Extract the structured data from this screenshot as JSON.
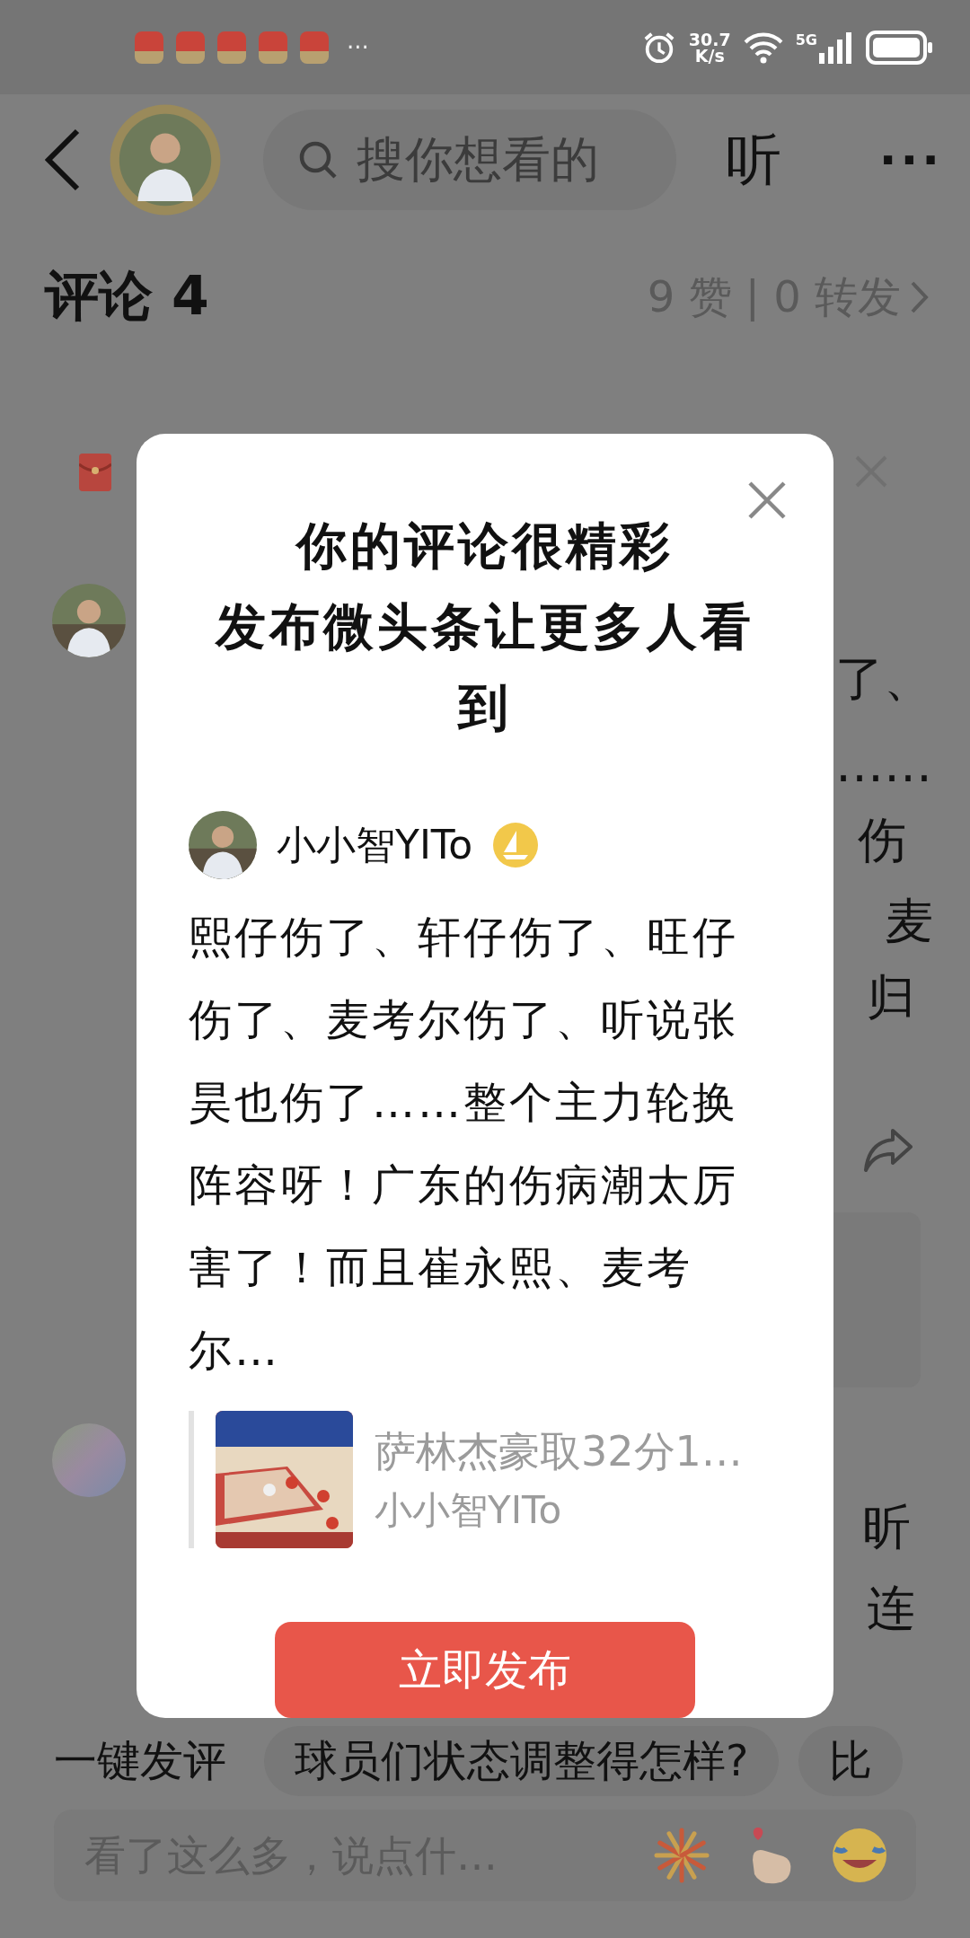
{
  "status_bar": {
    "more_notifications": "···",
    "network_speed": "30.7",
    "speed_unit": "K/s",
    "network_type": "5G"
  },
  "header": {
    "search": {
      "placeholder": "搜你想看的"
    },
    "listen_label": "听",
    "more": "···"
  },
  "comments_header": {
    "title": "评论 4",
    "stats": "9 赞 | 0 转发"
  },
  "background_fragments": [
    "了、",
    "……",
    "伤",
    "麦",
    "归",
    "昕",
    "连"
  ],
  "dialog": {
    "title_lines": [
      "你的评论很精彩",
      "发布微头条让更多人看到"
    ],
    "post": {
      "author": "小小智YITo",
      "text": "熙仔伤了、轩仔伤了、旺仔伤了、麦考尔伤了、听说张昊也伤了……整个主力轮换阵容呀！广东的伤病潮太厉害了！而且崔永熙、麦考尔…",
      "quote": {
        "title": "萨林杰豪取32分1…",
        "author": "小小智YITo"
      }
    },
    "button": "立即发布"
  },
  "quick_comment": {
    "label": "一键发评",
    "chips": [
      "球员们状态调整得怎样?",
      "比"
    ]
  },
  "input": {
    "placeholder": "看了这么多，说点什…"
  }
}
